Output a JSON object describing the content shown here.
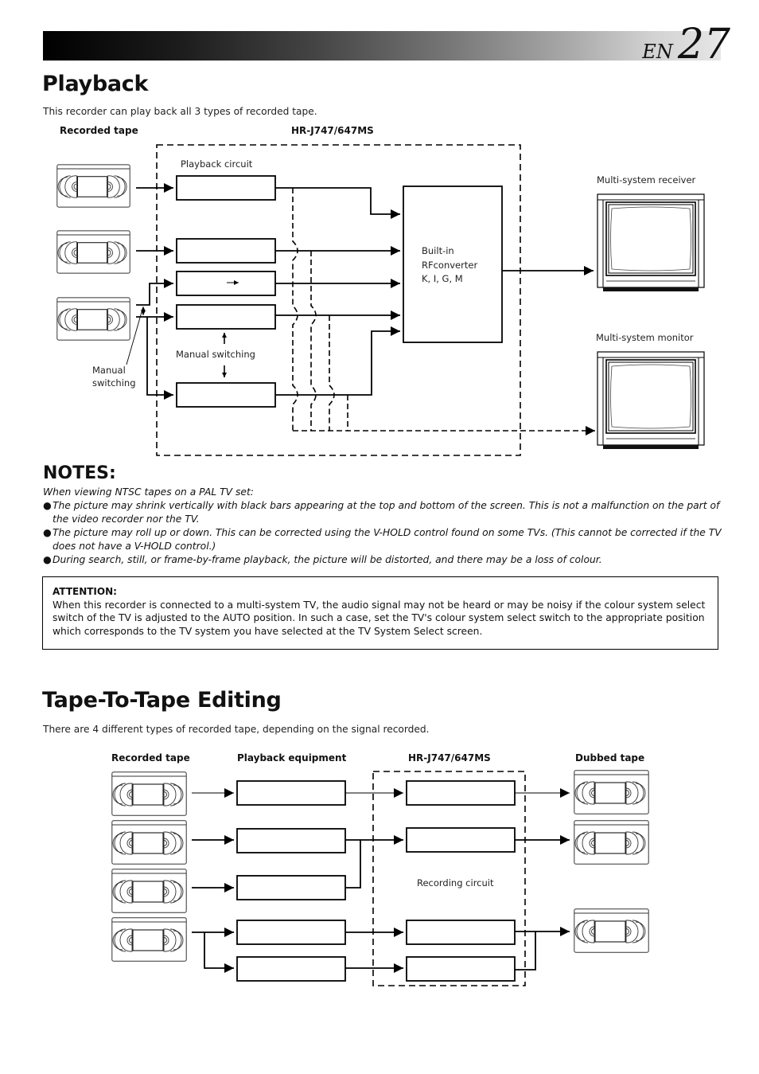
{
  "header": {
    "lang": "EN",
    "page_number": "27"
  },
  "playback": {
    "title": "Playback",
    "intro": "This recorder can play back all 3 types of recorded tape.",
    "diagram": {
      "recorded_tape_label": "Recorded tape",
      "model_label": "HR-J747/647MS",
      "playback_circuit_label": "Playback circuit",
      "manual_switching_inner": "Manual switching",
      "manual_switching_outer_line1": "Manual",
      "manual_switching_outer_line2": "switching",
      "rf_converter_line1": "Built-in",
      "rf_converter_line2": "RFconverter",
      "rf_converter_line3": "K, I, G, M",
      "receiver_label": "Multi-system receiver",
      "monitor_label": "Multi-system monitor",
      "icons": [
        "vhs-cassette-icon",
        "tv-set-icon"
      ]
    }
  },
  "notes": {
    "title": "NOTES:",
    "lead": "When viewing NTSC tapes on a PAL TV set:",
    "items": [
      "The picture may shrink vertically with black bars appearing at the top and bottom of the screen. This is not a malfunction on the part of the video recorder nor the TV.",
      "The picture may roll up or down. This can be corrected using the V-HOLD control found on some TVs. (This cannot be corrected if the TV does not have a V-HOLD control.)",
      "During search, still, or frame-by-frame playback, the picture will be distorted, and there may be a loss of colour."
    ],
    "bullet": "●"
  },
  "attention": {
    "title": "ATTENTION:",
    "text": "When this recorder is connected to a multi-system TV, the audio signal may not be heard or may be noisy if the colour system select switch of the TV is adjusted to the AUTO position. In such a case, set the TV's colour system select switch to the appropriate position which corresponds to the TV system you have selected at the TV System Select screen."
  },
  "editing": {
    "title": "Tape-To-Tape Editing",
    "intro": "There are 4 different types of recorded tape, depending on the signal recorded.",
    "diagram": {
      "recorded_tape_label": "Recorded tape",
      "playback_equipment_label": "Playback equipment",
      "model_label": "HR-J747/647MS",
      "dubbed_tape_label": "Dubbed tape",
      "recording_circuit_label": "Recording circuit"
    }
  }
}
